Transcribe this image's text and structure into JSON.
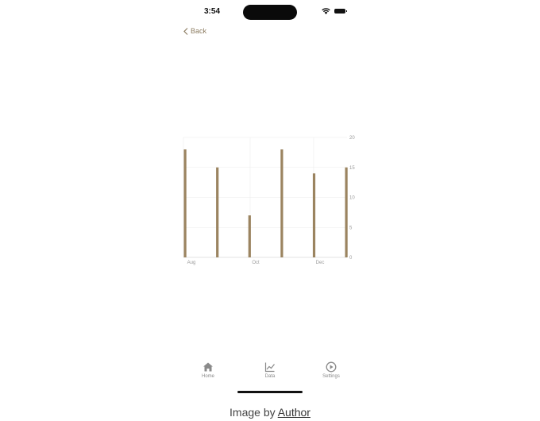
{
  "status_bar": {
    "time": "3:54"
  },
  "nav": {
    "back_label": "Back"
  },
  "chart_data": {
    "type": "bar",
    "x_tick_labels": [
      "Aug",
      "Oct",
      "Dec"
    ],
    "values": [
      18,
      15,
      7,
      18,
      14,
      15
    ],
    "y_ticks": [
      0,
      5,
      10,
      15,
      20
    ],
    "ylim": [
      0,
      20
    ],
    "grid": true,
    "bar_color": "#9b8460"
  },
  "tabbar": {
    "tabs": [
      {
        "label": "Home",
        "icon": "house-icon"
      },
      {
        "label": "Data",
        "icon": "chart-icon"
      },
      {
        "label": "Settings",
        "icon": "play-circle-icon"
      }
    ]
  },
  "caption": {
    "prefix": "Image by ",
    "link": "Author"
  }
}
